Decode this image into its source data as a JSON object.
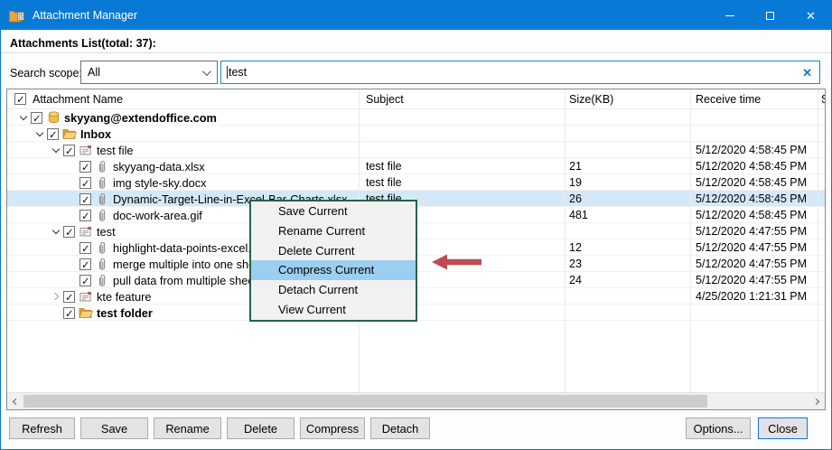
{
  "window": {
    "title": "Attachment Manager",
    "controls": {
      "minimize": "minimize",
      "maximize": "maximize",
      "close": "close"
    }
  },
  "header": {
    "list_label": "Attachments List(total: 37):"
  },
  "search": {
    "scope_label": "Search scope:",
    "scope_value": "All",
    "query": "test",
    "clear_icon": "x"
  },
  "table": {
    "columns": [
      "Attachment Name",
      "Subject",
      "Size(KB)",
      "Receive time",
      "S"
    ],
    "rows": [
      {
        "name": "skyyang@extendoffice.com",
        "level": 0,
        "icon": "account",
        "bold": true,
        "expander": "expanded",
        "selected": false,
        "subject": "",
        "size": "",
        "time": ""
      },
      {
        "name": "Inbox",
        "level": 1,
        "icon": "folder",
        "bold": true,
        "expander": "expanded",
        "selected": false,
        "subject": "",
        "size": "",
        "time": ""
      },
      {
        "name": "test file",
        "level": 2,
        "icon": "mail",
        "bold": false,
        "expander": "expanded",
        "selected": false,
        "subject": "",
        "size": "",
        "time": "5/12/2020 4:58:45 PM"
      },
      {
        "name": "skyyang-data.xlsx",
        "level": 3,
        "icon": "paperclip",
        "bold": false,
        "expander": "none",
        "selected": false,
        "subject": "test file",
        "size": "21",
        "time": "5/12/2020 4:58:45 PM"
      },
      {
        "name": "img style-sky.docx",
        "level": 3,
        "icon": "paperclip",
        "bold": false,
        "expander": "none",
        "selected": false,
        "subject": "test file",
        "size": "19",
        "time": "5/12/2020 4:58:45 PM"
      },
      {
        "name": "Dynamic-Target-Line-in-Excel-Bar-Charts.xlsx",
        "level": 3,
        "icon": "paperclip",
        "bold": false,
        "expander": "none",
        "selected": true,
        "subject": "test file",
        "size": "26",
        "time": "5/12/2020 4:58:45 PM"
      },
      {
        "name": "doc-work-area.gif",
        "level": 3,
        "icon": "paperclip",
        "bold": false,
        "expander": "none",
        "selected": false,
        "subject": "",
        "size": "481",
        "time": "5/12/2020 4:58:45 PM"
      },
      {
        "name": "test",
        "level": 2,
        "icon": "mail",
        "bold": false,
        "expander": "expanded",
        "selected": false,
        "subject": "",
        "size": "",
        "time": "5/12/2020 4:47:55 PM"
      },
      {
        "name": "highlight-data-points-excel.",
        "level": 3,
        "icon": "paperclip",
        "bold": false,
        "expander": "none",
        "selected": false,
        "subject": "",
        "size": "12",
        "time": "5/12/2020 4:47:55 PM"
      },
      {
        "name": "merge multiple into one shee",
        "level": 3,
        "icon": "paperclip",
        "bold": false,
        "expander": "none",
        "selected": false,
        "subject": "",
        "size": "23",
        "time": "5/12/2020 4:47:55 PM"
      },
      {
        "name": "pull data from multiple sheet",
        "level": 3,
        "icon": "paperclip",
        "bold": false,
        "expander": "none",
        "selected": false,
        "subject": "",
        "size": "24",
        "time": "5/12/2020 4:47:55 PM"
      },
      {
        "name": "kte feature",
        "level": 2,
        "icon": "mail",
        "bold": false,
        "expander": "collapsed",
        "selected": false,
        "subject": "",
        "size": "",
        "time": "4/25/2020 1:21:31 PM"
      },
      {
        "name": "test folder",
        "level": 2,
        "icon": "folder",
        "bold": true,
        "expander": "none",
        "selected": false,
        "subject": "",
        "size": "",
        "time": ""
      }
    ]
  },
  "context_menu": {
    "items": [
      "Save Current",
      "Rename Current",
      "Delete Current",
      "Compress Current",
      "Detach Current",
      "View Current"
    ],
    "highlighted_index": 3,
    "highlighted_item": "Compress Current"
  },
  "footer": {
    "buttons_left": [
      "Refresh",
      "Save",
      "Rename",
      "Delete",
      "Compress",
      "Detach"
    ],
    "buttons_right": [
      "Options...",
      "Close"
    ]
  },
  "colors": {
    "accent": "#0979D6",
    "selection": "#D3E9F8",
    "menu_highlight": "#9BCEF0",
    "menu_border": "#256442",
    "arrow": "#BE4B52"
  }
}
